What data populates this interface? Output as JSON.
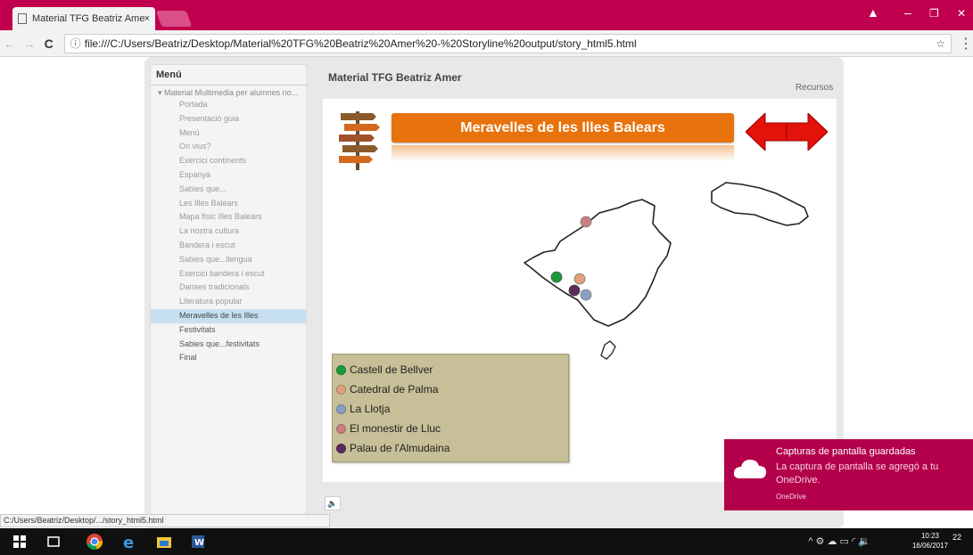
{
  "browser": {
    "tab_title": "Material TFG Beatriz Ame",
    "tab_close": "×",
    "back": "←",
    "forward": "→",
    "reload": "C",
    "info_icon": "ⓘ",
    "url": "file:///C:/Users/Beatriz/Desktop/Material%20TFG%20Beatriz%20Amer%20-%20Storyline%20output/story_html5.html",
    "star": "☆",
    "menu": "⋮",
    "status_url": "C:/Users/Beatriz/Desktop/.../story_html5.html",
    "win_user": "▲",
    "win_min": "–",
    "win_max": "❐",
    "win_close": "✕"
  },
  "player": {
    "menu_title": "Menú",
    "root_item": "▾ Material Multimedia per alumnes no...",
    "menu_items": [
      {
        "label": "Portada",
        "state": "light"
      },
      {
        "label": "Presentació guia",
        "state": "light"
      },
      {
        "label": "Menú",
        "state": "light"
      },
      {
        "label": "On vius?",
        "state": "light"
      },
      {
        "label": "Exercici continents",
        "state": "light"
      },
      {
        "label": "Espanya",
        "state": "light"
      },
      {
        "label": "Sabies que...",
        "state": "light"
      },
      {
        "label": "Les Illes Balears",
        "state": "light"
      },
      {
        "label": "Mapa físic Illes Balears",
        "state": "light"
      },
      {
        "label": "La nostra cultura",
        "state": "light"
      },
      {
        "label": "Bandera i escut",
        "state": "light"
      },
      {
        "label": "Sabies que...llengua",
        "state": "light"
      },
      {
        "label": "Exercici bandera i escut",
        "state": "light"
      },
      {
        "label": "Danses tradicionals",
        "state": "light"
      },
      {
        "label": "Literatura popular",
        "state": "light"
      },
      {
        "label": "Meravelles de les Illes",
        "state": "selected"
      },
      {
        "label": "Festivitats",
        "state": "dark"
      },
      {
        "label": "Sabies que...festivitats",
        "state": "dark"
      },
      {
        "label": "Final",
        "state": "dark"
      }
    ],
    "course_title": "Material TFG Beatriz Amer",
    "resources": "Recursos",
    "volume_icon": "🔈"
  },
  "slide": {
    "banner_title": "Meravelles de les Illes Balears",
    "banner_color": "#e8720c",
    "arrow_color": "#e3120b",
    "legend_bg": "#c7bf97",
    "legend": [
      {
        "label": "Castell de Bellver",
        "color": "#1a9a3a"
      },
      {
        "label": "Catedral de Palma",
        "color": "#e0a07c"
      },
      {
        "label": "La Llotja",
        "color": "#8aa0c0"
      },
      {
        "label": "El monestir de Lluc",
        "color": "#c98080"
      },
      {
        "label": "Palau de l'Almudaina",
        "color": "#5a2c5a"
      }
    ]
  },
  "toast": {
    "title": "Capturas de pantalla guardadas",
    "body": "La captura de pantalla se agregó a tu OneDrive.",
    "app": "OneDrive",
    "bg": "#b3004a"
  },
  "taskbar": {
    "tray": "^ ⚙ ☁ ▭ ◜ 🔉",
    "time": "10:23",
    "date": "16/06/2017",
    "notifications": "22"
  }
}
